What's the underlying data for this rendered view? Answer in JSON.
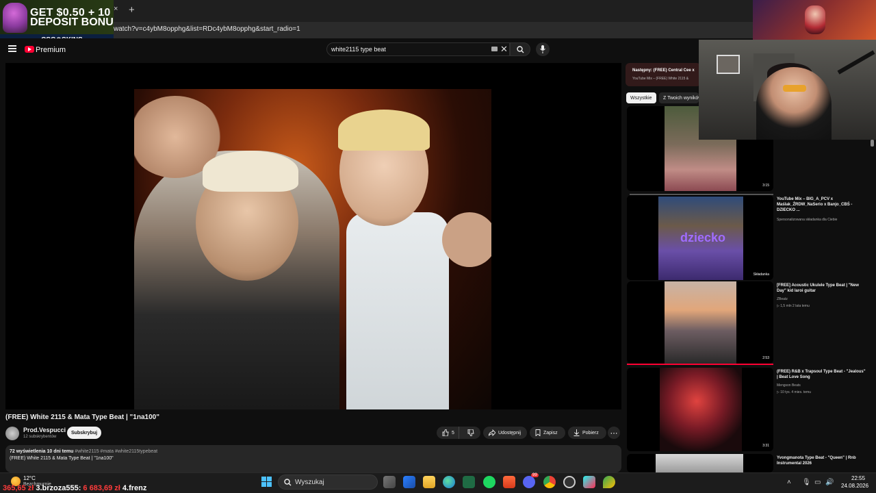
{
  "promo": {
    "line1": "GET $0.50 + 10",
    "line2": "DEPOSIT BONU",
    "brand": "CSG⊙SKINS",
    "brand_sub": "PL"
  },
  "browser": {
    "url": "watch?v=c4ybM8opphg&list=RDc4ybM8opphg&start_radio=1",
    "new_tab": "+",
    "close_tab": "×"
  },
  "header": {
    "brand": "Premium",
    "search_value": "white2115 type beat",
    "clear": "✕"
  },
  "video": {
    "title": "(FREE) White 2115 & Mata Type Beat | \"1na100\"",
    "channel": "Prod.Vespucci",
    "subscribers": "12 subskrybentów",
    "subscribe_label": "Subskrybuj",
    "likes": "5",
    "share_label": "Udostępnij",
    "save_label": "Zapisz",
    "download_label": "Pobierz",
    "more_label": "⋯",
    "desc_stats": "72 wyświetlenia  10 dni temu",
    "desc_tags": "#white2115 #mata #white2115typebeat",
    "desc_line2": "(FREE) White 2115 & Mata Type Beat | \"1na100\""
  },
  "up_next": {
    "title": "Następny: (FREE) Central Cee x",
    "subtitle": "YouTube Mix – (FREE) White 2115 &"
  },
  "chips": [
    "Wszystkie",
    "Z Twoich wyników"
  ],
  "recommendations": [
    {
      "title": "",
      "channel": "",
      "meta": "",
      "duration": "3:15"
    },
    {
      "title": "YouTube Mix – BIG_A_PCV x Maślak_ŹRDW_NaSerio x Banjo_CBŚ - DZIECKO ...",
      "channel": "Spersonalizowana składanka dla Ciebie",
      "meta": "",
      "duration": "Składanka",
      "overlay": "dziecko"
    },
    {
      "title": "[FREE] Acoustic Ukulele Type Beat | \"New Day\" kid laroi guitar",
      "channel": "ZBeatz",
      "meta": "1,5 mln  2 lata temu",
      "duration": "2:53"
    },
    {
      "title": "(FREE) R&B x Trapsoul Type Beat - \"Jealous\" | Beat Love Song",
      "channel": "Mengson Beats",
      "meta": "10 tys.  4 mies. temu",
      "duration": "3:31"
    },
    {
      "title": "Yvongmanota Type Beat - \"Queen\" | Rnb Instrumental 2026",
      "channel": "",
      "meta": "",
      "duration": ""
    }
  ],
  "taskbar": {
    "temp": "12°C",
    "weather": "Bezchmurnie",
    "search_label": "Wyszukaj",
    "leader_prefix": "365,65 zł",
    "leader_user3": "3.brzoza555:",
    "leader_amount3": "6 683,69 zł",
    "leader_user4": "4.frenz",
    "time": "22:55",
    "date": "24.08.2026",
    "discord_badge": "99"
  },
  "colors": {
    "accent_red": "#ff0033",
    "background": "#0f0f0f",
    "surface": "#272727"
  }
}
